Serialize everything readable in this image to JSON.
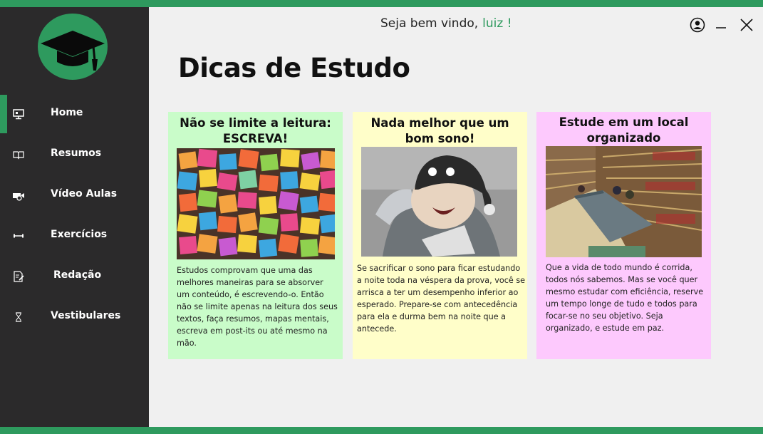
{
  "header": {
    "welcome_text": "Seja bem vindo,",
    "username": "luiz !"
  },
  "page": {
    "title": "Dicas de Estudo"
  },
  "sidebar": {
    "items": [
      {
        "label": "Home",
        "icon": "monitor-icon",
        "active": true
      },
      {
        "label": "Resumos",
        "icon": "book-icon",
        "active": false
      },
      {
        "label": "Vídeo Aulas",
        "icon": "video-camera-icon",
        "active": false
      },
      {
        "label": "Exercícios",
        "icon": "dumbbell-icon",
        "active": false
      },
      {
        "label": "Redação",
        "icon": "edit-document-icon",
        "active": false
      },
      {
        "label": "Vestibulares",
        "icon": "hourglass-icon",
        "active": false
      }
    ]
  },
  "cards": [
    {
      "title": "Não se limite a leitura: ESCREVA!",
      "image": "sticky-notes-wall",
      "text": "Estudos comprovam que uma das melhores maneiras para se absorver um conteúdo, é escrevendo-o. Então não se limite apenas na leitura dos seus textos, faça resumos, mapas mentais, escreva em post-its ou até mesmo na mão."
    },
    {
      "title": "Nada melhor que um bom sono!",
      "image": "sleepy-anime-character",
      "text": "Se sacrificar o sono para ficar estudando a noite toda na véspera da prova, você se arrisca a ter um desempenho inferior ao esperado. Prepare-se com antecedência para ela e durma bem na noite que a antecede."
    },
    {
      "title": "Estude em um local organizado",
      "image": "library-study-room",
      "text": "Que a vida de todo mundo é corrida, todos nós sabemos. Mas se você quer mesmo estudar com eficiência, reserve um tempo longe de tudo e todos para focar-se no seu objetivo. Seja organizado, e estude em paz."
    }
  ],
  "colors": {
    "accent": "#2e9a5e",
    "sidebar_bg": "#2b2a2b",
    "card1_bg": "#c9fcc9",
    "card2_bg": "#fffec9",
    "card3_bg": "#fdc9fd"
  }
}
